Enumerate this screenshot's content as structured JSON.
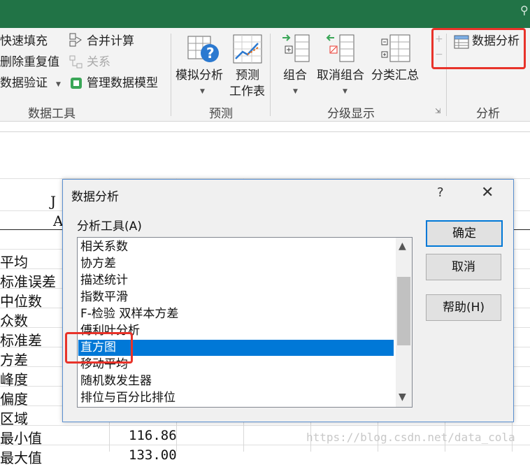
{
  "ribbon": {
    "data_tools": {
      "flash_fill": "快速填充",
      "remove_duplicates": "删除重复值",
      "data_validation": "数据验证",
      "consolidate": "合并计算",
      "relationships": "关系",
      "manage_data_model": "管理数据模型",
      "group_label": "数据工具"
    },
    "forecast": {
      "what_if": "模拟分析",
      "forecast_sheet_line1": "预测",
      "forecast_sheet_line2": "工作表",
      "group_label": "预测"
    },
    "outline": {
      "group": "组合",
      "ungroup": "取消组合",
      "subtotal": "分类汇总",
      "group_label": "分级显示"
    },
    "analysis": {
      "data_analysis": "数据分析",
      "group_label": "分析"
    }
  },
  "sheet": {
    "col_head_top": "J",
    "col_head_sub": "A",
    "row_labels": [
      "平均",
      "标准误差",
      "中位数",
      "众数",
      "标准差",
      "方差",
      "峰度",
      "偏度",
      "区域",
      "最小值",
      "最大值"
    ],
    "min_value": "116.86",
    "max_value_partial": "133.00",
    "watermark": "https://blog.csdn.net/data_cola"
  },
  "dialog": {
    "title": "数据分析",
    "help_glyph": "?",
    "close_glyph": "✕",
    "tools_label": "分析工具(A)",
    "items": [
      "相关系数",
      "协方差",
      "描述统计",
      "指数平滑",
      "F-检验 双样本方差",
      "傅利叶分析",
      "直方图",
      "移动平均",
      "随机数发生器",
      "排位与百分比排位"
    ],
    "selected_index": 6,
    "ok_label": "确定",
    "cancel_label": "取消",
    "help_label": "帮助(H)"
  },
  "colors": {
    "title_strip": "#217346",
    "selection": "#0078d7",
    "highlight": "#e8332a"
  }
}
